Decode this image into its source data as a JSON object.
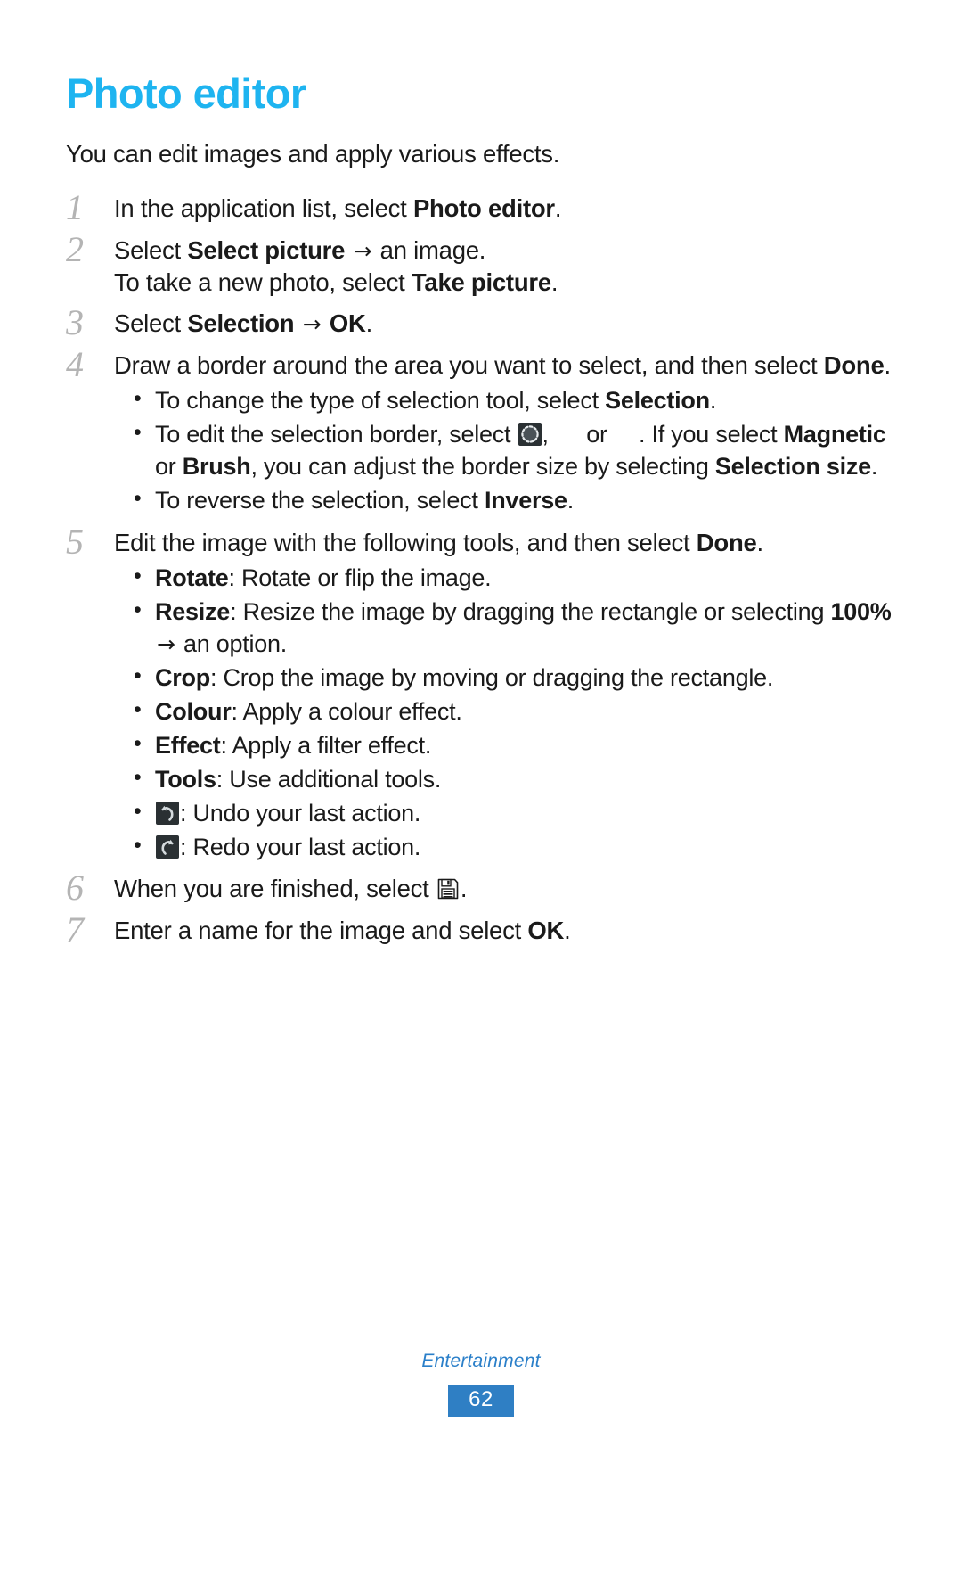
{
  "page": {
    "title": "Photo editor",
    "intro": "You can edit images and apply various effects.",
    "title_color": "#1eb4f0",
    "footer": {
      "section": "Entertainment",
      "page_number": "62",
      "badge_color": "#2f7fc4",
      "section_color": "#2a7fc9"
    }
  },
  "steps": [
    {
      "num": "1",
      "lines": [
        {
          "parts": [
            {
              "t": "In the application list, select ",
              "b": false
            },
            {
              "t": "Photo editor",
              "b": true
            },
            {
              "t": ".",
              "b": false
            }
          ]
        }
      ]
    },
    {
      "num": "2",
      "lines": [
        {
          "parts": [
            {
              "t": "Select ",
              "b": false
            },
            {
              "t": "Select picture",
              "b": true
            },
            {
              "t": " ",
              "b": false
            },
            {
              "t": "→",
              "arrow": true
            },
            {
              "t": " an image.",
              "b": false
            }
          ]
        },
        {
          "parts": [
            {
              "t": "To take a new photo, select ",
              "b": false
            },
            {
              "t": "Take picture",
              "b": true
            },
            {
              "t": ".",
              "b": false
            }
          ]
        }
      ]
    },
    {
      "num": "3",
      "lines": [
        {
          "parts": [
            {
              "t": "Select ",
              "b": false
            },
            {
              "t": "Selection",
              "b": true
            },
            {
              "t": " ",
              "b": false
            },
            {
              "t": "→",
              "arrow": true
            },
            {
              "t": " ",
              "b": false
            },
            {
              "t": "OK",
              "b": true
            },
            {
              "t": ".",
              "b": false
            }
          ]
        }
      ]
    },
    {
      "num": "4",
      "lines": [
        {
          "parts": [
            {
              "t": "Draw a border around the area you want to select, and then select ",
              "b": false
            },
            {
              "t": "Done",
              "b": true
            },
            {
              "t": ".",
              "b": false
            }
          ]
        }
      ],
      "bullets": [
        {
          "parts": [
            {
              "t": "To change the type of selection tool, select ",
              "b": false
            },
            {
              "t": "Selection",
              "b": true
            },
            {
              "t": ".",
              "b": false
            }
          ]
        },
        {
          "parts": [
            {
              "t": "To edit the selection border, select ",
              "b": false
            },
            {
              "icon": "magnetic-selection-icon"
            },
            {
              "t": ", ",
              "b": false
            },
            {
              "icon": "blank-icon-1"
            },
            {
              "t": " or ",
              "b": false
            },
            {
              "icon": "blank-icon-2"
            },
            {
              "t": ". If you select ",
              "b": false
            },
            {
              "t": "Magnetic",
              "b": true
            },
            {
              "t": " or ",
              "b": false
            },
            {
              "t": "Brush",
              "b": true
            },
            {
              "t": ", you can adjust the border size by selecting ",
              "b": false
            },
            {
              "t": "Selection size",
              "b": true
            },
            {
              "t": ".",
              "b": false
            }
          ]
        },
        {
          "parts": [
            {
              "t": "To reverse the selection, select ",
              "b": false
            },
            {
              "t": "Inverse",
              "b": true
            },
            {
              "t": ".",
              "b": false
            }
          ]
        }
      ]
    },
    {
      "num": "5",
      "lines": [
        {
          "parts": [
            {
              "t": "Edit the image with the following tools, and then select ",
              "b": false
            },
            {
              "t": "Done",
              "b": true
            },
            {
              "t": ".",
              "b": false
            }
          ]
        }
      ],
      "bullets": [
        {
          "parts": [
            {
              "t": "Rotate",
              "b": true
            },
            {
              "t": ": Rotate or flip the image.",
              "b": false
            }
          ]
        },
        {
          "parts": [
            {
              "t": "Resize",
              "b": true
            },
            {
              "t": ": Resize the image by dragging the rectangle or selecting ",
              "b": false
            },
            {
              "t": "100%",
              "b": true
            },
            {
              "t": " ",
              "b": false
            },
            {
              "t": "→",
              "arrow": true
            },
            {
              "t": " an option.",
              "b": false
            }
          ]
        },
        {
          "parts": [
            {
              "t": "Crop",
              "b": true
            },
            {
              "t": ": Crop the image by moving or dragging the rectangle.",
              "b": false
            }
          ]
        },
        {
          "parts": [
            {
              "t": "Colour",
              "b": true
            },
            {
              "t": ": Apply a colour effect.",
              "b": false
            }
          ]
        },
        {
          "parts": [
            {
              "t": "Effect",
              "b": true
            },
            {
              "t": ": Apply a filter effect.",
              "b": false
            }
          ]
        },
        {
          "parts": [
            {
              "t": "Tools",
              "b": true
            },
            {
              "t": ": Use additional tools.",
              "b": false
            }
          ]
        },
        {
          "parts": [
            {
              "icon": "undo-icon"
            },
            {
              "t": ": Undo your last action.",
              "b": false
            }
          ]
        },
        {
          "parts": [
            {
              "icon": "redo-icon"
            },
            {
              "t": ": Redo your last action.",
              "b": false
            }
          ]
        }
      ]
    },
    {
      "num": "6",
      "lines": [
        {
          "parts": [
            {
              "t": "When you are finished, select ",
              "b": false
            },
            {
              "icon": "save-icon"
            },
            {
              "t": ".",
              "b": false
            }
          ]
        }
      ]
    },
    {
      "num": "7",
      "lines": [
        {
          "parts": [
            {
              "t": "Enter a name for the image and select ",
              "b": false
            },
            {
              "t": "OK",
              "b": true
            },
            {
              "t": ".",
              "b": false
            }
          ]
        }
      ]
    }
  ]
}
